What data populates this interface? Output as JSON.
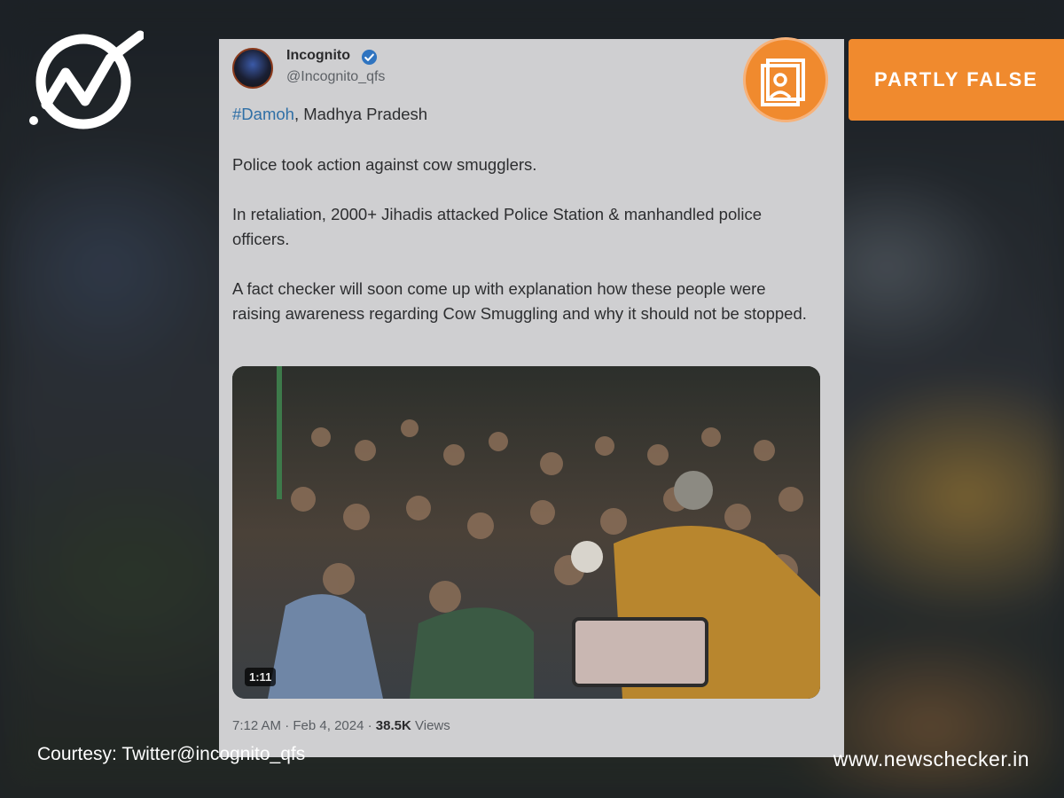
{
  "tweet": {
    "author_name": "Incognito",
    "handle": "@Incognito_qfs",
    "hashtag": "#Damoh",
    "location_rest": ", Madhya Pradesh",
    "para1": "Police took action against cow smugglers.",
    "para2": "In retaliation, 2000+ Jihadis attacked Police Station & manhandled police officers.",
    "para3": "A fact checker will soon come up with explanation how these people were raising awareness regarding Cow Smuggling and why it should not be stopped.",
    "video_duration": "1:11",
    "time": "7:12 AM",
    "date": "Feb 4, 2024",
    "views_count": "38.5K",
    "views_label": "Views"
  },
  "verdict": {
    "label": "PARTLY FALSE",
    "color": "#f08a2e"
  },
  "footer": {
    "courtesy": "Courtesy: Twitter@incognito_qfs",
    "site": "www.newschecker.in"
  },
  "icons": {
    "logo": "newschecker-logo",
    "verified": "verified-badge-icon",
    "badge": "profile-card-icon"
  }
}
